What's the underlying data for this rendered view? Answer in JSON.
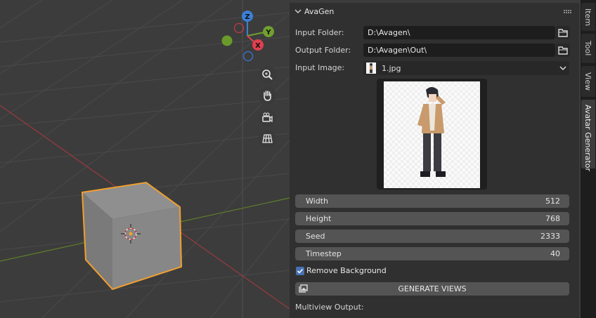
{
  "viewport": {
    "gizmo": {
      "z_label": "Z",
      "y_label": "Y",
      "x_label": "X"
    },
    "nav_icons": [
      "zoom-icon",
      "hand-pan-icon",
      "camera-icon",
      "grid-ortho-icon"
    ]
  },
  "panel": {
    "title": "AvaGen",
    "input_folder": {
      "label": "Input Folder:",
      "value": "D:\\Avagen\\"
    },
    "output_folder": {
      "label": "Output Folder:",
      "value": "D:\\Avagen\\Out\\"
    },
    "input_image": {
      "label": "Input Image:",
      "value": "1.jpg"
    },
    "width": {
      "label": "Width",
      "value": "512"
    },
    "height": {
      "label": "Height",
      "value": "768"
    },
    "seed": {
      "label": "Seed",
      "value": "2333"
    },
    "timestep": {
      "label": "Timestep",
      "value": "40"
    },
    "remove_background": {
      "label": "Remove Background",
      "checked": true
    },
    "generate_button": "GENERATE VIEWS",
    "multiview_output_label": "Multiview Output:"
  },
  "side_tabs": [
    "Item",
    "Tool",
    "View",
    "Avatar Generator"
  ],
  "colors": {
    "accent": "#4772b3",
    "selection": "#f0a030",
    "x_axis": "#e0404f",
    "y_axis": "#70a030",
    "z_axis": "#3a80d8"
  }
}
